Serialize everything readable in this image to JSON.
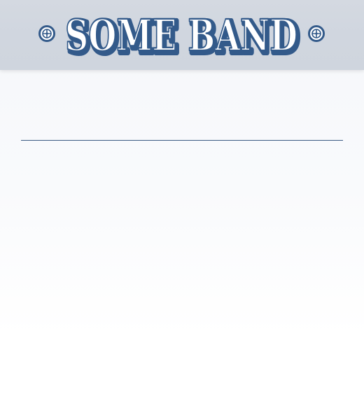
{
  "header": {
    "band_name": "SOME BAND",
    "colors": {
      "header_bg": "#d2d8e0",
      "logo_stroke": "#335a8a",
      "logo_fill": "#ffffff",
      "divider": "#3b5a83"
    }
  },
  "icons": {
    "left_ornament": "ornament-icon",
    "right_ornament": "ornament-icon"
  }
}
